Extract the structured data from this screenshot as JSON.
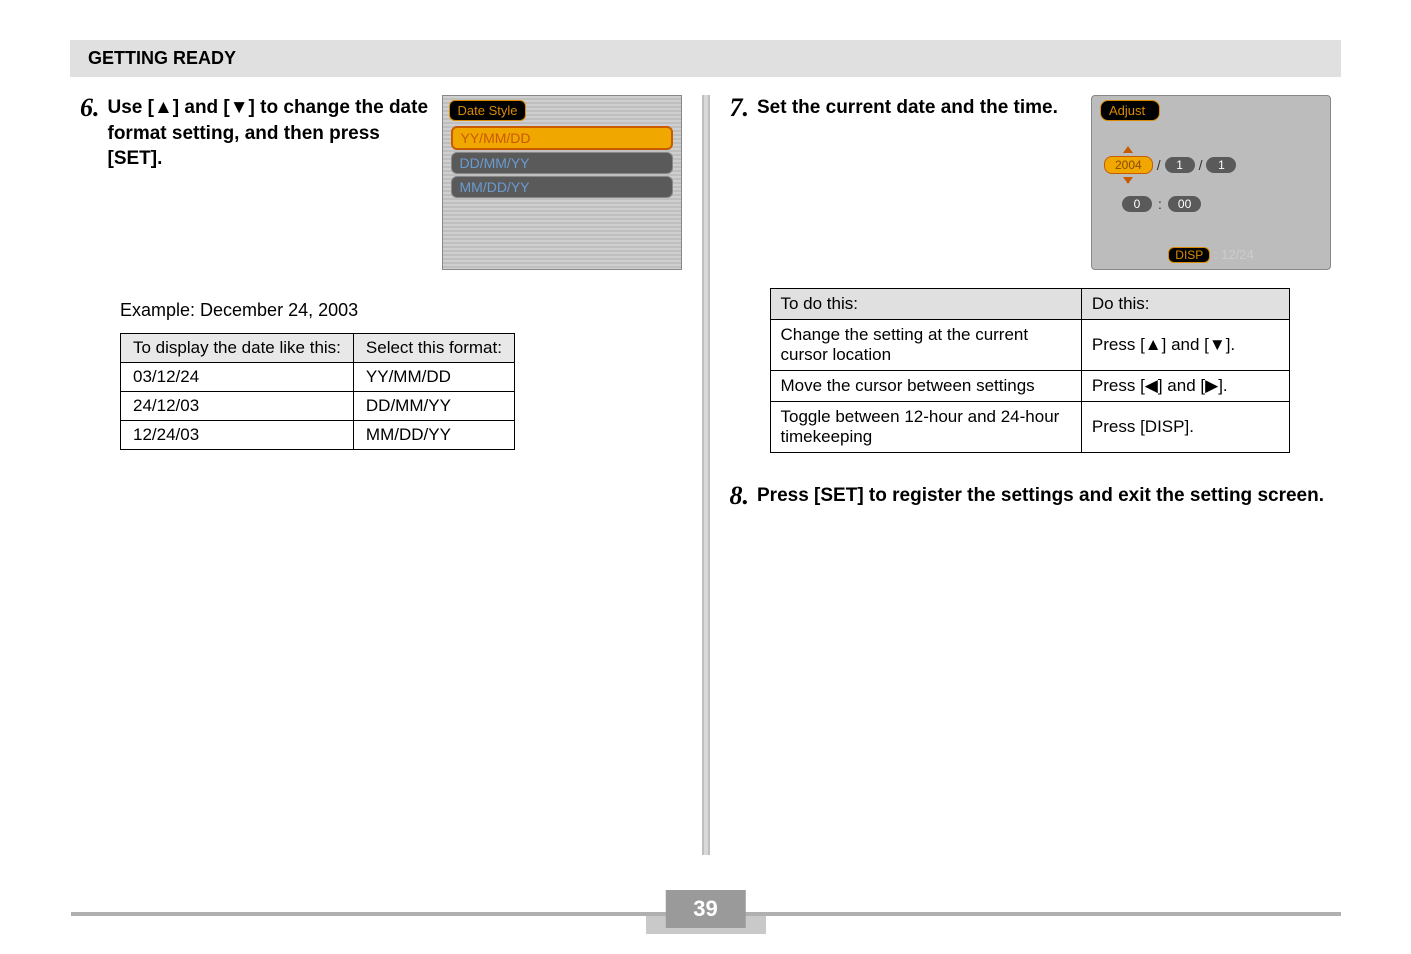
{
  "section_title": "GETTING READY",
  "page_number": "39",
  "step6": {
    "num": "6.",
    "text": "Use [▲] and [▼] to change the date format setting, and then press [SET].",
    "screen_title": "Date Style",
    "options": [
      "YY/MM/DD",
      "DD/MM/YY",
      "MM/DD/YY"
    ]
  },
  "example_label": "Example: December 24, 2003",
  "fmt_table": {
    "h1": "To display the date like this:",
    "h2": "Select this format:",
    "rows": [
      {
        "a": "03/12/24",
        "b": "YY/MM/DD"
      },
      {
        "a": "24/12/03",
        "b": "DD/MM/YY"
      },
      {
        "a": "12/24/03",
        "b": "MM/DD/YY"
      }
    ]
  },
  "step7": {
    "num": "7.",
    "text": "Set the current date and the time.",
    "screen_title": "Adjust",
    "year": "2004",
    "month": "1",
    "day": "1",
    "hour": "0",
    "min": "00",
    "disp_label": "DISP",
    "time_fmt": ": 12/24"
  },
  "act_table": {
    "h1": "To do this:",
    "h2": "Do this:",
    "rows": [
      {
        "a": "Change the setting at the current cursor location",
        "b": "Press [▲] and [▼]."
      },
      {
        "a": "Move the cursor between settings",
        "b": "Press [◀] and [▶]."
      },
      {
        "a": "Toggle between 12-hour and 24-hour timekeeping",
        "b": "Press [DISP]."
      }
    ]
  },
  "step8": {
    "num": "8.",
    "text": "Press [SET] to register the settings and exit the setting screen."
  }
}
